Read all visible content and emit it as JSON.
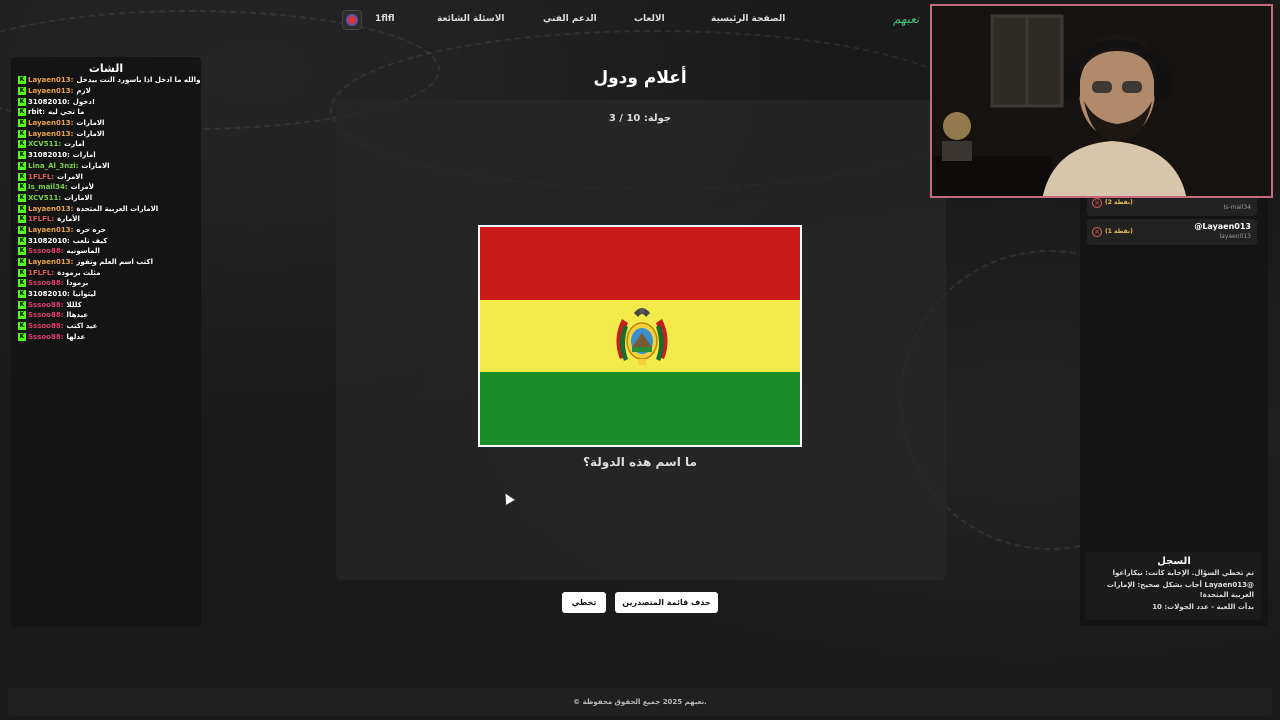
{
  "nav": {
    "username": "1flfl",
    "items": [
      "الاسئلة الشائعة",
      "الدعم الفني",
      "الالعاب",
      "الصفحة الرئيسية"
    ],
    "brand": "نعبهم"
  },
  "chat": {
    "title": "الشات",
    "badge": "K",
    "messages": [
      {
        "user": "Layaen013:",
        "text": "والله ما ادخل اذا باسورد النت بيدخل",
        "color": "#e8a24a"
      },
      {
        "user": "Layaen013:",
        "text": "لازم",
        "color": "#e8a24a"
      },
      {
        "user": "31082010:",
        "text": "دخول!",
        "color": "#ffffff"
      },
      {
        "user": "rbit:",
        "text": "ما تجي ليه",
        "color": "#ffffff"
      },
      {
        "user": "Layaen013:",
        "text": "الامارات",
        "color": "#e8a24a"
      },
      {
        "user": "Layaen013:",
        "text": "الامارات",
        "color": "#e8a24a"
      },
      {
        "user": "XCV511:",
        "text": "امارت",
        "color": "#7bd34a"
      },
      {
        "user": "31082010:",
        "text": "امارات",
        "color": "#ffffff"
      },
      {
        "user": "Lina_Al_3nzi:",
        "text": "الامارات",
        "color": "#7bd34a"
      },
      {
        "user": "1FLFL:",
        "text": "الامرات",
        "color": "#e05a5a"
      },
      {
        "user": "Is_mail34:",
        "text": "لأمرات",
        "color": "#7bd34a"
      },
      {
        "user": "XCV511:",
        "text": "الامارات",
        "color": "#7bd34a"
      },
      {
        "user": "Layaen013:",
        "text": "الامارات العربية المتحدة",
        "color": "#e8a24a"
      },
      {
        "user": "1FLFL:",
        "text": "الأمارة",
        "color": "#e05a5a"
      },
      {
        "user": "Layaen013:",
        "text": "حره حره",
        "color": "#e8a24a"
      },
      {
        "user": "31082010:",
        "text": "كيف نلعب",
        "color": "#ffffff"
      },
      {
        "user": "Sssoo88:",
        "text": "الماسونيه",
        "color": "#e03a6a"
      },
      {
        "user": "Layaen013:",
        "text": "اكتب اسم العلم وتفوز",
        "color": "#e8a24a"
      },
      {
        "user": "1FLFL:",
        "text": "مثلث برمودة",
        "color": "#e05a5a"
      },
      {
        "user": "Sssoo88:",
        "text": "برمودا",
        "color": "#e03a6a"
      },
      {
        "user": "31082010:",
        "text": "ليتوانيا",
        "color": "#ffffff"
      },
      {
        "user": "Sssoo88:",
        "text": "كلللا",
        "color": "#e03a6a"
      },
      {
        "user": "Sssoo88:",
        "text": "عيدهاا",
        "color": "#e03a6a"
      },
      {
        "user": "Sssoo88:",
        "text": "عيد اكتب",
        "color": "#e03a6a"
      },
      {
        "user": "Sssoo88:",
        "text": "عدلها",
        "color": "#e03a6a"
      }
    ]
  },
  "game": {
    "title": "أعلام ودول",
    "round": "جولة: 10 / 3",
    "question": "ما اسم هذه الدولة؟",
    "flag_colors": [
      "#cc1a1a",
      "#f2e94a",
      "#1a8c2a"
    ],
    "skip_label": "تخطي",
    "clear_label": "حذف قائمة المتصدرين"
  },
  "leaderboard": [
    {
      "name": "",
      "sub": "Is-mail34",
      "points": "(2 نقطة)"
    },
    {
      "name": "@Layaen013",
      "sub": "layaen013",
      "points": "(1 نقطة)"
    }
  ],
  "log": {
    "title": "السجل",
    "lines": [
      "تم تخطي السؤال. الإجابة كانت: نيكاراغوا",
      "@Layaen013 أجاب بشكل صحيح: الإمارات العربية المتحدة!",
      "بدأت اللعبة - عدد الجولات: 10"
    ]
  },
  "footer": {
    "text": "© نعبهم 2025 جميع الحقوق محفوظة."
  }
}
